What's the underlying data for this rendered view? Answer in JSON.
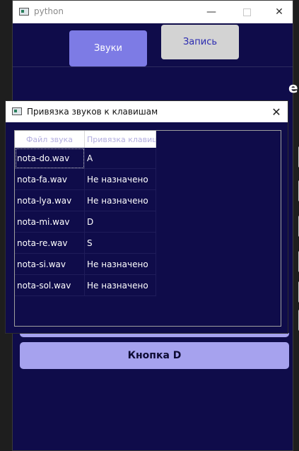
{
  "main_window": {
    "title": "python",
    "controls": {
      "minimize": "—",
      "close": "✕"
    },
    "tabs": {
      "sounds": "Звуки",
      "record": "Запись"
    },
    "key_button_label": "Кнопка D",
    "bg_letter": "е"
  },
  "dialog": {
    "title": "Привязка звуков к клавишам",
    "close": "✕",
    "columns": [
      "Файл звука",
      "Привязка клавиш"
    ],
    "rows": [
      {
        "file": "nota-do.wav",
        "key": "A"
      },
      {
        "file": "nota-fa.wav",
        "key": "Не назначено"
      },
      {
        "file": "nota-lya.wav",
        "key": "Не назначено"
      },
      {
        "file": "nota-mi.wav",
        "key": "D"
      },
      {
        "file": "nota-re.wav",
        "key": "S"
      },
      {
        "file": "nota-si.wav",
        "key": "Не назначено"
      },
      {
        "file": "nota-sol.wav",
        "key": "Не назначено"
      }
    ]
  },
  "colors": {
    "background": "#0f0c4a",
    "tab_active": "#7d7be5",
    "tab_inactive": "#d3d3d3",
    "key_button": "#a6a2ee"
  },
  "icons": [
    "app-icon",
    "minimize-icon",
    "maximize-icon",
    "close-icon"
  ]
}
